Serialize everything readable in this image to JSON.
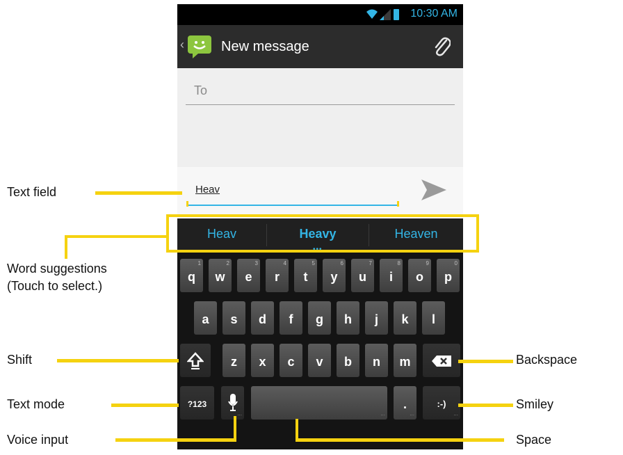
{
  "status": {
    "time": "10:30 AM"
  },
  "header": {
    "title": "New message"
  },
  "to": {
    "placeholder": "To"
  },
  "compose": {
    "text": "Heav"
  },
  "suggestions": [
    "Heav",
    "Heavy",
    "Heaven"
  ],
  "keyboard": {
    "row1": [
      {
        "k": "q",
        "h": "1"
      },
      {
        "k": "w",
        "h": "2"
      },
      {
        "k": "e",
        "h": "3"
      },
      {
        "k": "r",
        "h": "4"
      },
      {
        "k": "t",
        "h": "5"
      },
      {
        "k": "y",
        "h": "6"
      },
      {
        "k": "u",
        "h": "7"
      },
      {
        "k": "i",
        "h": "8"
      },
      {
        "k": "o",
        "h": "9"
      },
      {
        "k": "p",
        "h": "0"
      }
    ],
    "row2": [
      "a",
      "s",
      "d",
      "f",
      "g",
      "h",
      "j",
      "k",
      "l"
    ],
    "row3": [
      "z",
      "x",
      "c",
      "v",
      "b",
      "n",
      "m"
    ],
    "mode": "?123",
    "period": ".",
    "smiley": ":-)"
  },
  "callouts": {
    "text_field": "Text field",
    "suggestions_1": "Word suggestions",
    "suggestions_2": "(Touch to select.)",
    "shift": "Shift",
    "text_mode": "Text mode",
    "voice": "Voice input",
    "backspace": "Backspace",
    "smiley": "Smiley",
    "space": "Space"
  },
  "colors": {
    "accent": "#33b5e5",
    "callout": "#f5d210"
  }
}
